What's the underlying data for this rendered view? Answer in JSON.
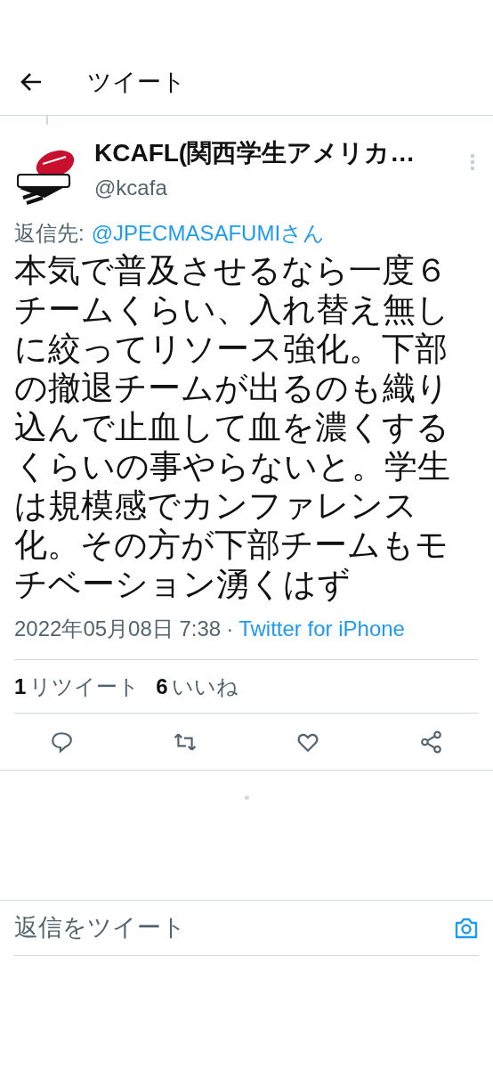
{
  "header": {
    "title": "ツイート"
  },
  "tweet": {
    "name": "KCAFL(関西学生アメリカ…",
    "handle": "@kcafa",
    "reply_label": "返信先:",
    "reply_to": "@JPECMASAFUMIさん",
    "text": "本気で普及させるなら一度６チームくらい、入れ替え無しに絞ってリソース強化。下部の撤退チームが出るのも織り込んで止血して血を濃くするくらいの事やらないと。学生は規模感でカンファレンス化。その方が下部チームもモチベーション湧くはず",
    "date": "2022年05月08日 7:38",
    "separator": "·",
    "source": "Twitter for iPhone"
  },
  "stats": [
    {
      "count": "1",
      "label": "リツイート"
    },
    {
      "count": "6",
      "label": "いいね"
    }
  ],
  "actions": [
    {
      "kind": "reply"
    },
    {
      "kind": "retweet"
    },
    {
      "kind": "like"
    },
    {
      "kind": "share"
    }
  ],
  "reply_box": {
    "placeholder": "返信をツイート"
  }
}
